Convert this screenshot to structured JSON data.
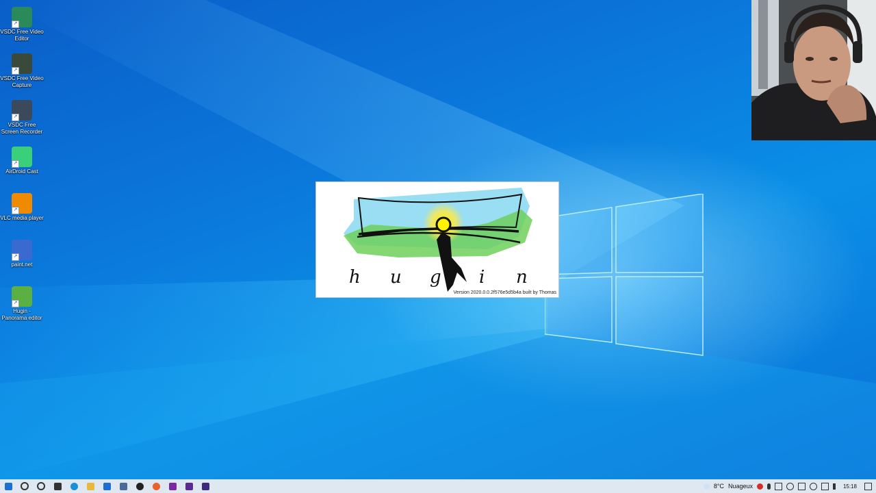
{
  "desktop": {
    "icons": [
      {
        "label": "VSDC Free Video Editor",
        "icon": "vsdc-editor-icon",
        "color": "#2a8a5a"
      },
      {
        "label": "VSDC Free Video Capture",
        "icon": "vsdc-capture-icon",
        "color": "#3a4a3a"
      },
      {
        "label": "VSDC Free Screen Recorder",
        "icon": "vsdc-recorder-icon",
        "color": "#3a4a5a"
      },
      {
        "label": "AirDroid Cast",
        "icon": "airdroid-cast-icon",
        "color": "#3ad07a"
      },
      {
        "label": "VLC media player",
        "icon": "vlc-icon",
        "color": "#f08a00"
      },
      {
        "label": "paint.net",
        "icon": "paintnet-icon",
        "color": "#3a6ad0"
      },
      {
        "label": "Hugin - Panorama editor",
        "icon": "hugin-icon",
        "color": "#5ab040"
      }
    ]
  },
  "splash": {
    "letters": [
      "h",
      "u",
      "g",
      "i",
      "n"
    ],
    "version": "Version 2020.0.0.2f576e5d5b4a built by Thomas"
  },
  "taskbar": {
    "apps": [
      {
        "name": "start-button",
        "icon": "windows-icon",
        "color": "#1a6fd0"
      },
      {
        "name": "search-button",
        "icon": "search-icon",
        "color": "#333333"
      },
      {
        "name": "cortana-button",
        "icon": "cortana-icon",
        "color": "#333333"
      },
      {
        "name": "task-view-button",
        "icon": "task-view-icon",
        "color": "#333333"
      },
      {
        "name": "edge-button",
        "icon": "edge-icon",
        "color": "#1b8fd6"
      },
      {
        "name": "file-explorer-button",
        "icon": "folder-icon",
        "color": "#e8b93a"
      },
      {
        "name": "mail-button",
        "icon": "mail-icon",
        "color": "#1a6fd0"
      },
      {
        "name": "app-button",
        "icon": "app-icon",
        "color": "#4a6a9a"
      },
      {
        "name": "obs-button",
        "icon": "obs-icon",
        "color": "#222222"
      },
      {
        "name": "firefox-button",
        "icon": "firefox-icon",
        "color": "#e8632a"
      },
      {
        "name": "vsdc-button-1",
        "icon": "vsdc-icon",
        "color": "#7a2aa0"
      },
      {
        "name": "vsdc-button-2",
        "icon": "vsdc-icon",
        "color": "#5a2a90"
      },
      {
        "name": "vsdc-button-3",
        "icon": "vsdc-icon",
        "color": "#3a2a80"
      }
    ],
    "weather_temp": "8°C",
    "weather_text": "Nuageux",
    "clock": "15:18"
  }
}
